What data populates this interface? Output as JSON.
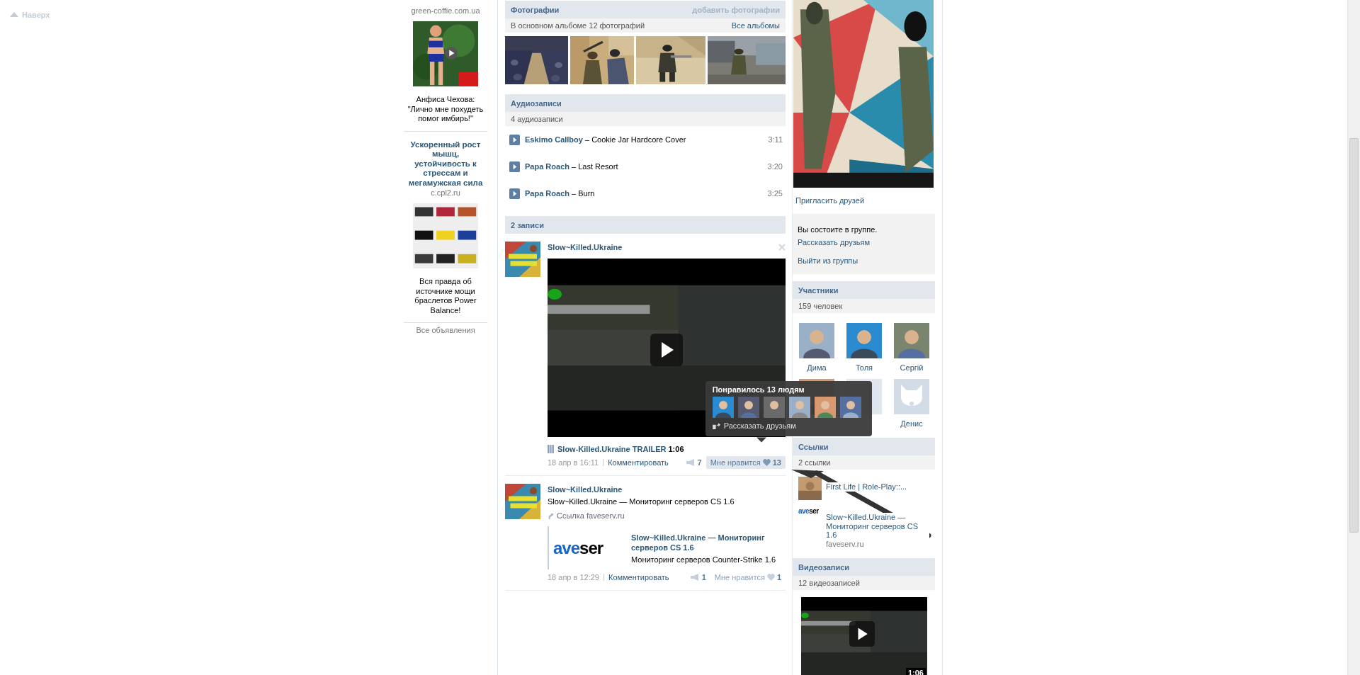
{
  "back_to_top": {
    "label": "Наверх"
  },
  "ads": [
    {
      "domain": "green-coffie.com.ua",
      "image": {
        "kind": "picture",
        "video": true
      },
      "text": "Анфиса Чехова: \"Лично мне похудеть помог имбирь!\""
    },
    {
      "title": "Ускоренный рост мышц, устойчивость к стрессам и мегамужская сила",
      "domain": "c.cpl2.ru",
      "image": {
        "kind": "picture",
        "video": false
      },
      "text": "Вся правда об источнике мощи браслетов Power Balance!"
    }
  ],
  "ads_footer": "Все объявления",
  "photos": {
    "title": "Фотографии",
    "action": "добавить фотографии",
    "summary": "В основном альбоме 12 фотографий",
    "all_link": "Все альбомы",
    "items": [
      {
        "kind": "picture"
      },
      {
        "kind": "picture"
      },
      {
        "kind": "picture"
      },
      {
        "kind": "picture"
      }
    ]
  },
  "audio": {
    "title": "Аудиозаписи",
    "summary": "4 аудиозаписи",
    "tracks": [
      {
        "artist": "Eskimo Callboy",
        "song": "– Cookie Jar Hardcore Cover",
        "duration": "3:11"
      },
      {
        "artist": "Papa Roach",
        "song": "– Last Resort",
        "duration": "3:20"
      },
      {
        "artist": "Papa Roach",
        "song": "– Burn",
        "duration": "3:25"
      }
    ]
  },
  "wall": {
    "title": "2 записи",
    "posts": [
      {
        "author": "Slow~Killed.Ukraine",
        "kind": "video",
        "closable": true,
        "video": {
          "title": "Slow-Killed.Ukraine TRAILER",
          "duration": "1:06"
        },
        "date": "18 апр в 16:11",
        "comment": "Комментировать",
        "shares": "7",
        "like_label": "Мне нравится",
        "likes": "13",
        "like_hovered": true,
        "likes_popup": {
          "title": "Понравилось 13 людям",
          "avatars": [
            {
              "kind": "picture"
            },
            {
              "kind": "picture"
            },
            {
              "kind": "picture"
            },
            {
              "kind": "picture"
            },
            {
              "kind": "picture"
            },
            {
              "kind": "picture"
            }
          ],
          "share": "Рассказать друзьям"
        }
      },
      {
        "author": "Slow~Killed.Ukraine",
        "kind": "link",
        "closable": false,
        "text": "Slow~Killed.Ukraine — Мониторинг серверов CS 1.6",
        "link_label": "Ссылка faveserv.ru",
        "attachment": {
          "logo": [
            "ave",
            "ser"
          ],
          "title": "Slow~Killed.Ukraine — Мониторинг серверов CS 1.6",
          "description": "Мониторинг серверов Counter-Strike 1.6"
        },
        "date": "18 апр в 12:29",
        "comment": "Комментировать",
        "shares": "1",
        "like_label": "Мне нравится",
        "likes": "1",
        "like_hovered": false
      }
    ]
  },
  "sidebar": {
    "invite": "Пригласить друзей",
    "membership": {
      "status": "Вы состоите в группе.",
      "tell": "Рассказать друзьям",
      "leave": "Выйти из группы"
    },
    "members": {
      "title": "Участники",
      "count": "159 человек",
      "people": [
        {
          "name": "Дима",
          "kind": "picture"
        },
        {
          "name": "Толя",
          "kind": "picture"
        },
        {
          "name": "Сергій",
          "kind": "picture"
        },
        {
          "kind": "picture"
        },
        {
          "kind": "no_photo"
        },
        {
          "name": "Денис",
          "kind": "deleted"
        }
      ]
    },
    "links": {
      "title": "Ссылки",
      "count": "2 ссылки",
      "items": [
        {
          "title": "First Life | Role-Play::...",
          "icon": {
            "kind": "picture"
          }
        },
        {
          "title": "Slow~Killed.Ukraine — Мониторинг серверов CS 1.6",
          "domain": "faveserv.ru",
          "icon": {
            "kind": "logo",
            "logo": [
              "ave",
              "ser"
            ]
          }
        }
      ]
    },
    "videos": {
      "title": "Видеозаписи",
      "count": "12 видеозаписей",
      "items": [
        {
          "duration": "1:06"
        }
      ]
    }
  }
}
